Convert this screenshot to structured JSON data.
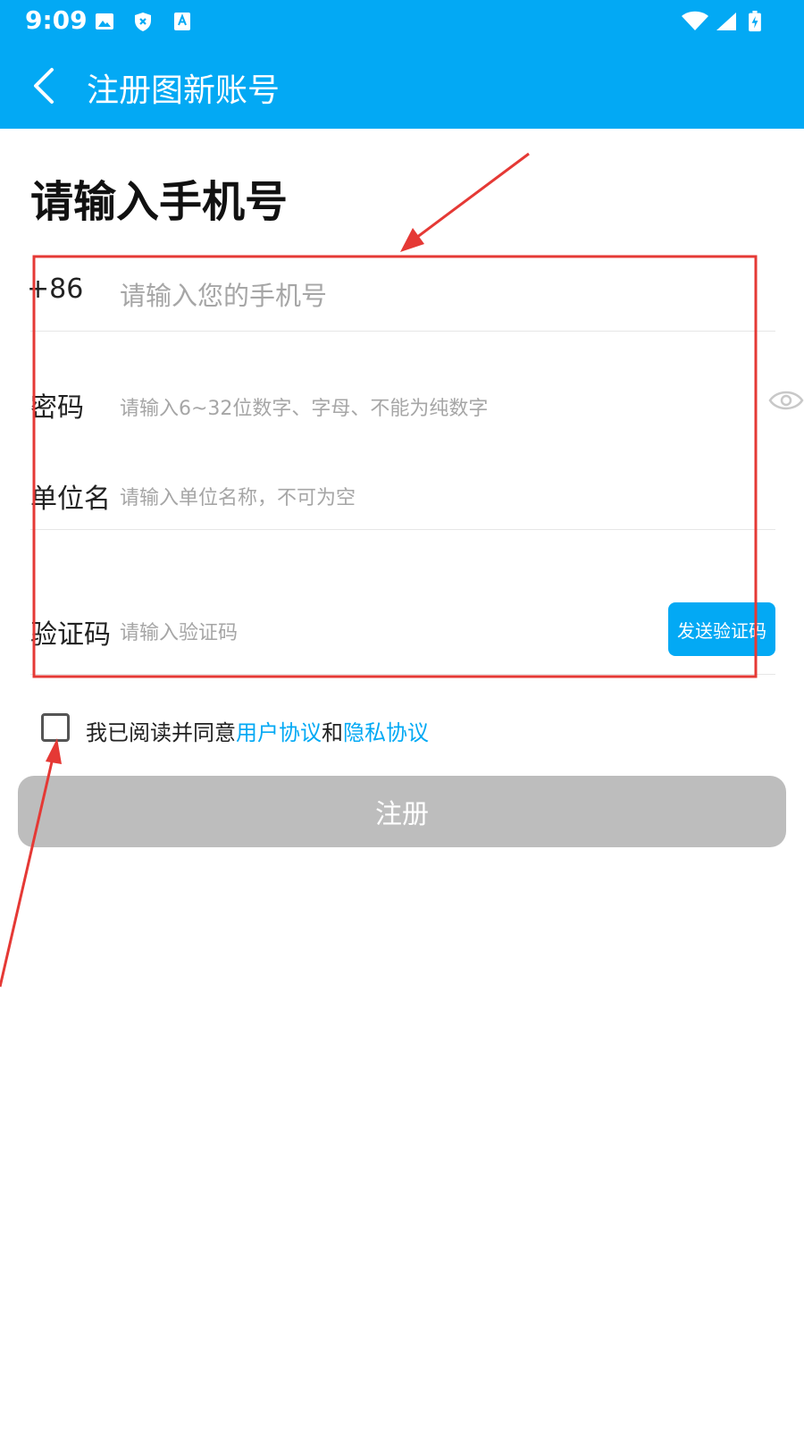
{
  "status_bar": {
    "time": "9:09"
  },
  "app_bar": {
    "title": "注册图新账号"
  },
  "heading": "请输入手机号",
  "form": {
    "phone": {
      "label": "+86",
      "placeholder": "请输入您的手机号"
    },
    "password": {
      "label": "密码",
      "placeholder": "请输入6~32位数字、字母、不能为纯数字"
    },
    "company": {
      "label": "单位名",
      "placeholder": "请输入单位名称，不可为空"
    },
    "code": {
      "label": "验证码",
      "placeholder": "请输入验证码",
      "send_button": "发送验证码"
    }
  },
  "agreement": {
    "prefix": "我已阅读并同意",
    "user_link": "用户协议",
    "and": "和",
    "privacy_link": "隐私协议",
    "checked": false
  },
  "register_button": "注册",
  "colors": {
    "accent": "#03a9f4",
    "annotation_red": "#e53935",
    "disabled_button": "#bdbdbd"
  }
}
